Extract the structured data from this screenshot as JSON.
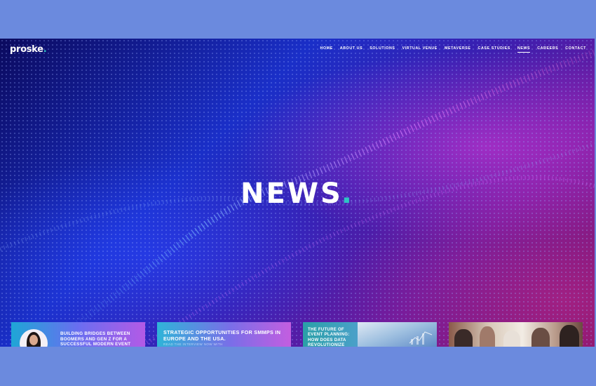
{
  "site": {
    "logo_text": "proske",
    "logo_dot": "."
  },
  "nav": {
    "items": [
      {
        "label": "HOME",
        "active": false
      },
      {
        "label": "ABOUT US",
        "active": false
      },
      {
        "label": "SOLUTIONS",
        "active": false
      },
      {
        "label": "VIRTUAL VENUE",
        "active": false
      },
      {
        "label": "METAVERSE",
        "active": false
      },
      {
        "label": "CASE STUDIES",
        "active": false
      },
      {
        "label": "NEWS",
        "active": true
      },
      {
        "label": "CAREERS",
        "active": false
      },
      {
        "label": "CONTACT",
        "active": false
      }
    ]
  },
  "hero": {
    "title": "NEWS",
    "title_dot": "."
  },
  "cards": [
    {
      "title": "BUILDING BRIDGES BETWEEN BOOMERS AND GEN Z FOR A SUCCESSFUL MODERN EVENT"
    },
    {
      "title": "STRATEGIC OPPORTUNITIES FOR SMMPS IN EUROPE AND THE USA.",
      "subtitle": "READ THE INTERVIEW NOW WITH"
    },
    {
      "title": "THE FUTURE OF EVENT PLANNING: HOW DOES DATA REVOLUTIONIZE"
    },
    {
      "title": ""
    }
  ],
  "colors": {
    "page_bg": "#6b8ade",
    "accent_teal": "#2ec4c4",
    "hero_deep_blue": "#0b0a5e",
    "hero_magenta": "#7a1060"
  },
  "icons": {
    "avatar": "portrait-photo",
    "data_chart": "chart-overlay"
  }
}
